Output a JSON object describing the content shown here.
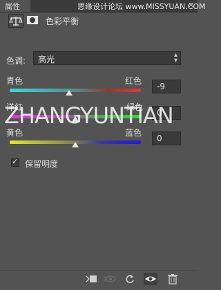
{
  "panel": {
    "tab_label": "属性",
    "close_glyph": "✕",
    "watermark_top": "思缘设计论坛 www.MISSYUAN.COM",
    "watermark_mid": "ZHANGYUNTIAN"
  },
  "header": {
    "title": "色彩平衡",
    "adjustment_icon": "balance-scale-icon",
    "mask_icon": "mask-icon"
  },
  "tone": {
    "label": "色调:",
    "value": "高光"
  },
  "sliders": [
    {
      "left": "青色",
      "right": "红色",
      "value": "-9",
      "position_fraction": 0.45
    },
    {
      "left": "洋红",
      "right": "绿色",
      "value": "0",
      "position_fraction": 0.5
    },
    {
      "left": "黄色",
      "right": "蓝色",
      "value": "0",
      "position_fraction": 0.5
    }
  ],
  "preserve": {
    "label": "保留明度",
    "checked": true
  },
  "bottom_icons": [
    "clip-to-layer-icon",
    "view-previous-icon",
    "reset-icon",
    "visibility-eye-icon",
    "trash-icon"
  ]
}
